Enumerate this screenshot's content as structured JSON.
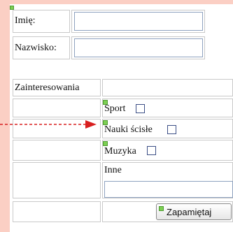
{
  "form": {
    "first_name_label": "Imię:",
    "last_name_label": "Nazwisko:",
    "interests_label": "Zainteresowania",
    "checkboxes": {
      "sport": "Sport",
      "science": "Nauki ścisłe",
      "music": "Muzyka"
    },
    "other_label": "Inne",
    "submit_label": "Zapamiętaj"
  }
}
